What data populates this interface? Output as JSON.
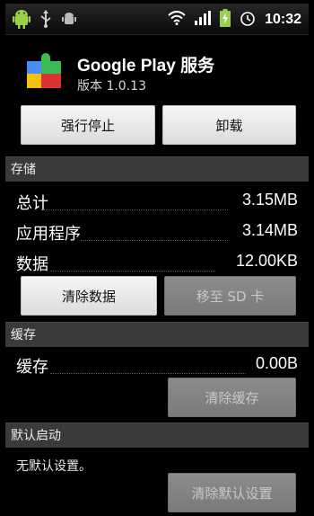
{
  "status_bar": {
    "time": "10:32",
    "left_icons": [
      "android-icon",
      "usb-icon",
      "debug-icon"
    ],
    "right_icons": [
      "wifi-icon",
      "signal-icon",
      "battery-icon",
      "alarm-icon"
    ]
  },
  "app": {
    "name": "Google Play 服务",
    "version": "版本 1.0.13"
  },
  "buttons": {
    "force_stop": "强行停止",
    "uninstall": "卸载",
    "clear_data": "清除数据",
    "move_to_sd": "移至 SD 卡",
    "clear_cache": "清除缓存",
    "clear_defaults": "清除默认设置"
  },
  "storage": {
    "header": "存储",
    "rows": [
      {
        "label": "总计",
        "value": "3.15MB"
      },
      {
        "label": "应用程序",
        "value": "3.14MB"
      },
      {
        "label": "数据",
        "value": "12.00KB"
      }
    ]
  },
  "cache": {
    "header": "缓存",
    "label": "缓存",
    "value": "0.00B"
  },
  "default_launch": {
    "header": "默认启动",
    "text": "无默认设置。"
  },
  "colors": {
    "background": "#000000",
    "section_header": "#3a3a3a",
    "button": "#e8e8e8",
    "button_disabled": "#808080"
  }
}
